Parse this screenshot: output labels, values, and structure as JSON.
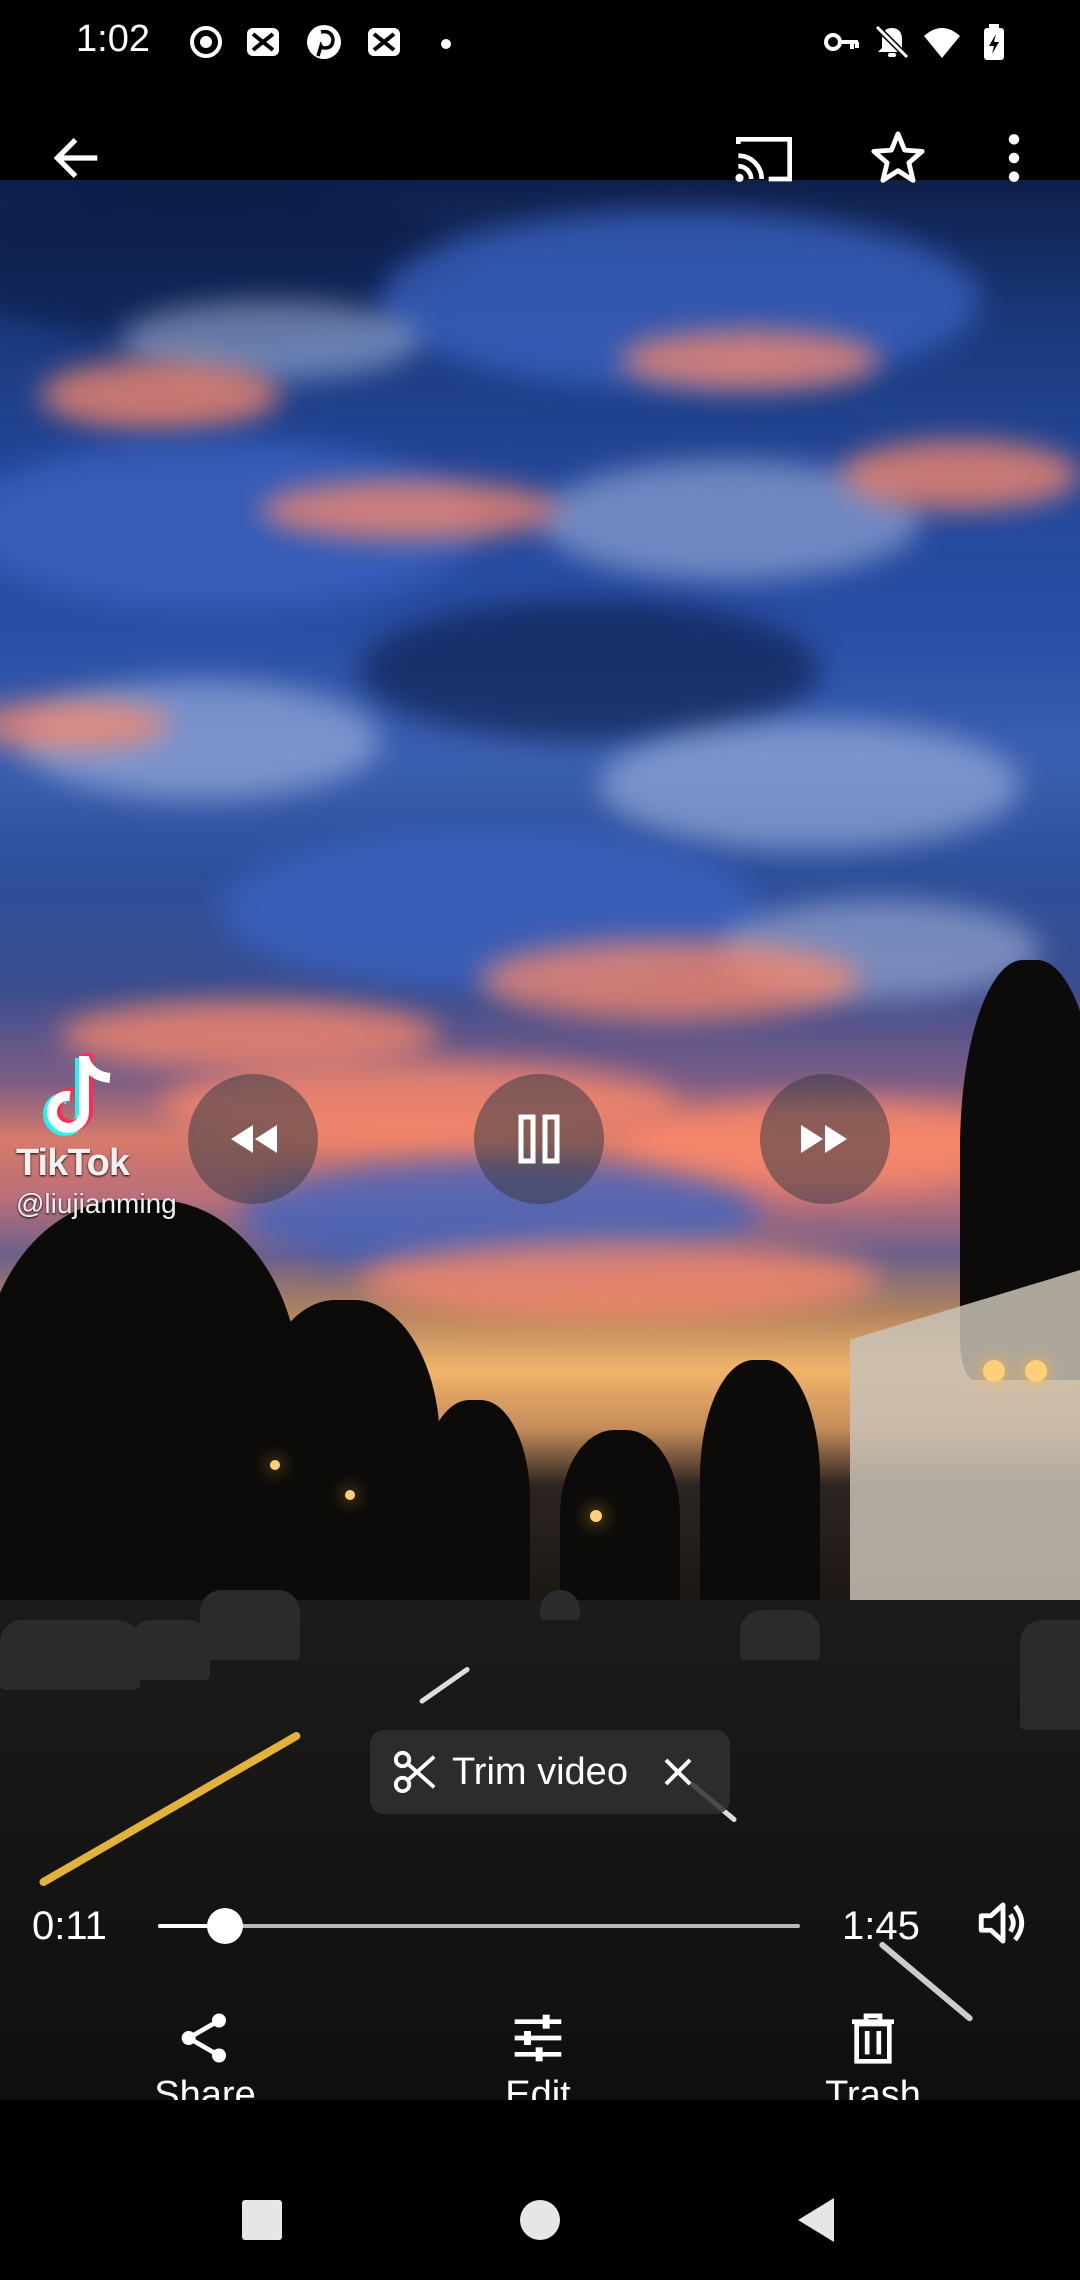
{
  "status_bar": {
    "time": "1:02",
    "left_icons": [
      "record-icon",
      "notification-icon",
      "pinterest-icon",
      "notification-icon",
      "dot-icon"
    ],
    "right_icons": [
      "vpn-key-icon",
      "silent-bell-icon",
      "wifi-icon",
      "battery-charging-icon"
    ]
  },
  "top_bar": {
    "icons": [
      "back-arrow-icon",
      "cast-icon",
      "star-icon",
      "more-vert-icon"
    ]
  },
  "video": {
    "watermark_brand": "TikTok",
    "watermark_user": "@liujianming"
  },
  "playback": {
    "controls": [
      "rewind-icon",
      "pause-icon",
      "fast-forward-icon"
    ]
  },
  "trim": {
    "label": "Trim video"
  },
  "seek": {
    "current": "0:11",
    "total": "1:45",
    "progress": 0.105
  },
  "actions": [
    {
      "label": "Share",
      "icon": "share-icon"
    },
    {
      "label": "Edit",
      "icon": "tune-icon"
    },
    {
      "label": "Trash",
      "icon": "trash-icon"
    }
  ],
  "nav": [
    "recents-square-icon",
    "home-circle-icon",
    "back-triangle-icon"
  ],
  "colors": {
    "overlay": "#303034",
    "track": "#b8b8b8",
    "accent_orange": "#ff8a6a",
    "sky_blue": "#2a4fa5"
  }
}
